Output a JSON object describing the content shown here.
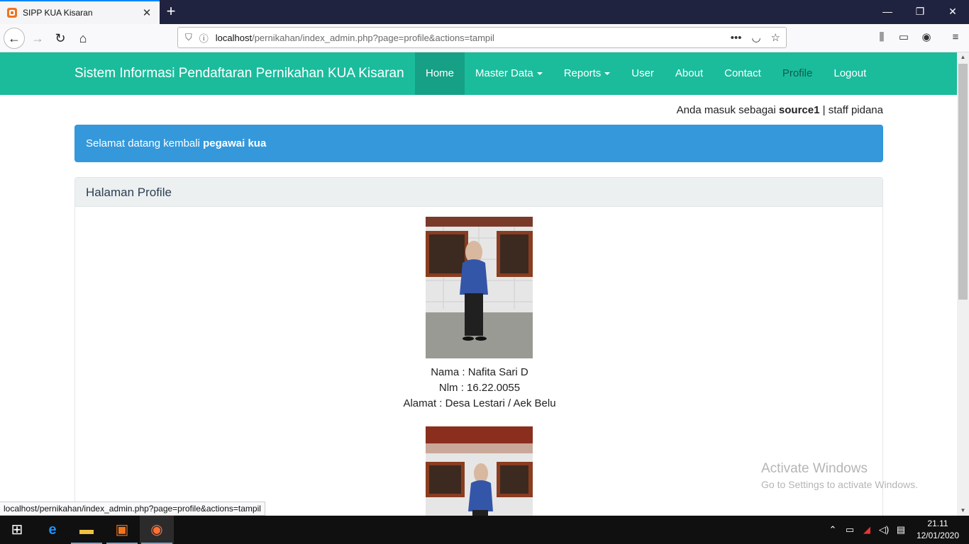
{
  "browser": {
    "tab_title": "SIPP KUA Kisaran",
    "url_host": "localhost",
    "url_path": "/pernikahan/index_admin.php?page=profile&actions=tampil",
    "status_url": "localhost/pernikahan/index_admin.php?page=profile&actions=tampil"
  },
  "nav": {
    "brand": "Sistem Informasi Pendaftaran Pernikahan KUA Kisaran",
    "items": [
      {
        "label": "Home"
      },
      {
        "label": "Master Data"
      },
      {
        "label": "Reports"
      },
      {
        "label": "User"
      },
      {
        "label": "About"
      },
      {
        "label": "Contact"
      },
      {
        "label": "Profile"
      },
      {
        "label": "Logout"
      }
    ]
  },
  "login": {
    "prefix": "Anda masuk sebagai",
    "username": "source1",
    "separator": "|",
    "role": "staff pidana"
  },
  "alert": {
    "prefix": "Selamat datang kembali",
    "name": "pegawai kua"
  },
  "panel": {
    "title": "Halaman Profile",
    "profile": {
      "nama": "Nama : Nafita Sari D",
      "nim": "Nlm : 16.22.0055",
      "alamat": "Alamat : Desa Lestari / Aek Belu"
    }
  },
  "watermark": {
    "title": "Activate Windows",
    "subtitle": "Go to Settings to activate Windows."
  },
  "taskbar": {
    "time": "21.11",
    "date": "12/01/2020"
  },
  "colors": {
    "navbar": "#1abc9c",
    "navbar_active": "#16a085",
    "alert": "#3498db",
    "panel_heading": "#ecf0f1"
  }
}
